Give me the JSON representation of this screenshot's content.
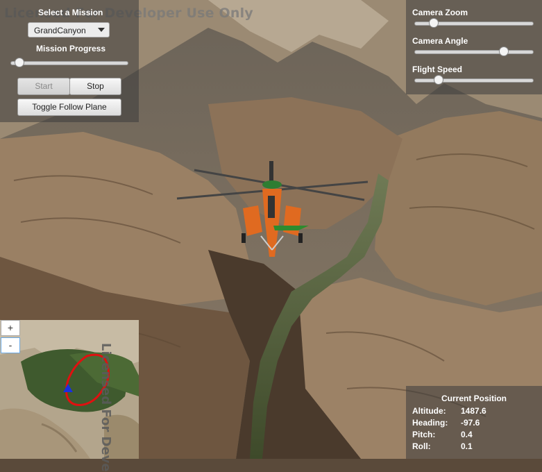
{
  "watermark": "Licensed For Developer Use Only",
  "minimap_watermark": "Licensed For Deve",
  "mission_panel": {
    "select_label": "Select a Mission",
    "mission_selected": "GrandCanyon",
    "progress_label": "Mission Progress",
    "progress_value": 0.04,
    "start_label": "Start",
    "stop_label": "Stop",
    "toggle_label": "Toggle Follow Plane"
  },
  "camera_panel": {
    "zoom_label": "Camera Zoom",
    "zoom_value": 0.13,
    "angle_label": "Camera Angle",
    "angle_value": 0.77,
    "speed_label": "Flight Speed",
    "speed_value": 0.18
  },
  "minimap": {
    "zoom_in": "+",
    "zoom_out": "-"
  },
  "position_panel": {
    "title": "Current Position",
    "rows": [
      {
        "key": "Altitude:",
        "value": "1487.6"
      },
      {
        "key": "Heading:",
        "value": "-97.6"
      },
      {
        "key": "Pitch:",
        "value": "0.4"
      },
      {
        "key": "Roll:",
        "value": "0.1"
      }
    ]
  },
  "colors": {
    "panel_bg": "#3c3c3c",
    "route": "#e01010",
    "plane_marker": "#1a2fe0",
    "helicopter_body": "#e06a20"
  }
}
